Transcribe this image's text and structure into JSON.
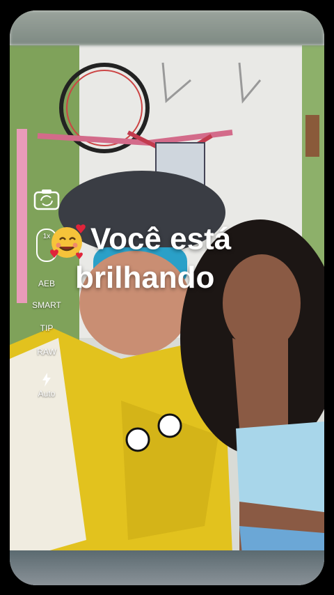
{
  "controls": {
    "lens_label": "1x",
    "aeb_label": "AEB",
    "smart_label": "SMART",
    "tip_label": "TIP",
    "raw_label": "RAW",
    "flash_label": "Auto"
  },
  "overlay": {
    "line1": "Você está",
    "line2": "brilhando"
  },
  "icons": {
    "camera_flip": "camera-switch-icon",
    "flash": "lightning-bolt-icon",
    "emoji": "smiling-face-with-hearts-icon"
  },
  "colors": {
    "jersey_yellow": "#e2c21e",
    "wall": "#e6e6e2",
    "top_blue": "#a8d6ea"
  }
}
